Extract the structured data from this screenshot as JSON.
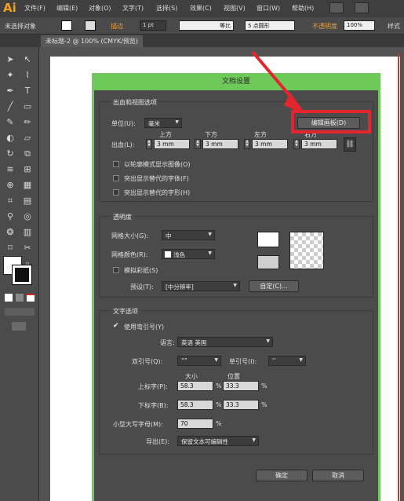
{
  "app": {
    "logo": "Ai"
  },
  "menu": [
    "文件(F)",
    "编辑(E)",
    "对象(O)",
    "文字(T)",
    "选择(S)",
    "效果(C)",
    "视图(V)",
    "窗口(W)",
    "帮助(H)"
  ],
  "control_bar": {
    "no_selection": "未选择对象",
    "stroke_label": "描边",
    "stroke_value": "1 pt",
    "uniform": "等比",
    "brush": "5 点圆形",
    "opacity_label": "不透明度",
    "opacity_value": "100%",
    "style_label": "样式"
  },
  "document_tab": "未标题-2 @ 100% (CMYK/预览)",
  "dialog": {
    "title": "文档设置",
    "bleed_group": {
      "title": "出血和视图选项",
      "units_label": "单位(U):",
      "units_value": "毫米",
      "edit_artboards": "编辑画板(D)",
      "bleed_label": "出血(L):",
      "cols": [
        "上方",
        "下方",
        "左方",
        "右方"
      ],
      "values": [
        "3 mm",
        "3 mm",
        "3 mm",
        "3 mm"
      ],
      "options": [
        "以轮廓模式显示图像(O)",
        "突出显示替代的字体(F)",
        "突出显示替代的字形(H)"
      ]
    },
    "transparency_group": {
      "title": "透明度",
      "grid_size_label": "网格大小(G):",
      "grid_size_value": "中",
      "grid_color_label": "网格颜色(R):",
      "grid_color_value": "浅色",
      "simulate_paper": "模拟彩纸(S)",
      "preset_label": "预设(T):",
      "preset_value": "[中分辨率]",
      "custom_button": "自定(C)..."
    },
    "type_group": {
      "title": "文字选项",
      "use_typographers_quotes": "使用弯引号(Y)",
      "language_label": "语言:",
      "language_value": "英语  美国",
      "double_quotes_label": "双引号(Q):",
      "double_quotes_value": "“”",
      "single_quotes_label": "单引号(I):",
      "single_quotes_value": "‘’",
      "col_size": "大小",
      "col_position": "位置",
      "superscript_label": "上标字(P):",
      "superscript_size": "58.3",
      "superscript_position": "33.3",
      "subscript_label": "下标字(B):",
      "subscript_size": "58.3",
      "subscript_position": "33.3",
      "percent": "%",
      "small_caps_label": "小型大写字母(M):",
      "small_caps_value": "70",
      "export_label": "导出(E):",
      "export_value": "保留文本可编辑性"
    },
    "ok_button": "确定",
    "cancel_button": "取消"
  }
}
